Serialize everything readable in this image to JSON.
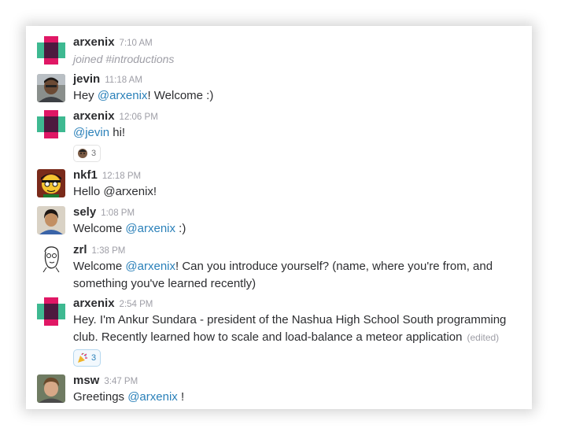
{
  "colors": {
    "mention": "#2a80b9",
    "name": "#2c2d30",
    "timestamp": "#9e9ea6"
  },
  "messages": [
    {
      "avatar": "arxenix-logo-avatar",
      "name": "arxenix",
      "time": "7:10 AM",
      "system_text": "joined #introductions"
    },
    {
      "avatar": "jevin-photo-avatar",
      "name": "jevin",
      "time": "11:18 AM",
      "pre": "Hey ",
      "mention": "@arxenix",
      "post": "! Welcome :)"
    },
    {
      "avatar": "arxenix-logo-avatar",
      "name": "arxenix",
      "time": "12:06 PM",
      "pre": "",
      "mention": "@jevin",
      "post": " hi!",
      "reaction": {
        "icon": "person-face-emoji",
        "count": "3"
      }
    },
    {
      "avatar": "nkf1-cartoon-avatar",
      "name": "nkf1",
      "time": "12:18 PM",
      "text": "Hello @arxenix!"
    },
    {
      "avatar": "sely-photo-avatar",
      "name": "sely",
      "time": "1:08 PM",
      "pre": "Welcome ",
      "mention": "@arxenix",
      "post": " :)"
    },
    {
      "avatar": "zrl-sketch-avatar",
      "name": "zrl",
      "time": "1:38 PM",
      "pre": "Welcome ",
      "mention": "@arxenix",
      "post": "! Can you introduce yourself? (name, where you're from, and something you've learned recently)"
    },
    {
      "avatar": "arxenix-logo-avatar",
      "name": "arxenix",
      "time": "2:54 PM",
      "text": "Hey. I'm Ankur Sundara - president of the Nashua High School South programming club. Recently learned how to scale and load-balance a meteor application",
      "edited": "(edited)",
      "reaction": {
        "icon": "party-popper-emoji",
        "count": "3"
      }
    },
    {
      "avatar": "msw-photo-avatar",
      "name": "msw",
      "time": "3:47 PM",
      "pre": "Greetings ",
      "mention": "@arxenix",
      "post": " !"
    }
  ]
}
